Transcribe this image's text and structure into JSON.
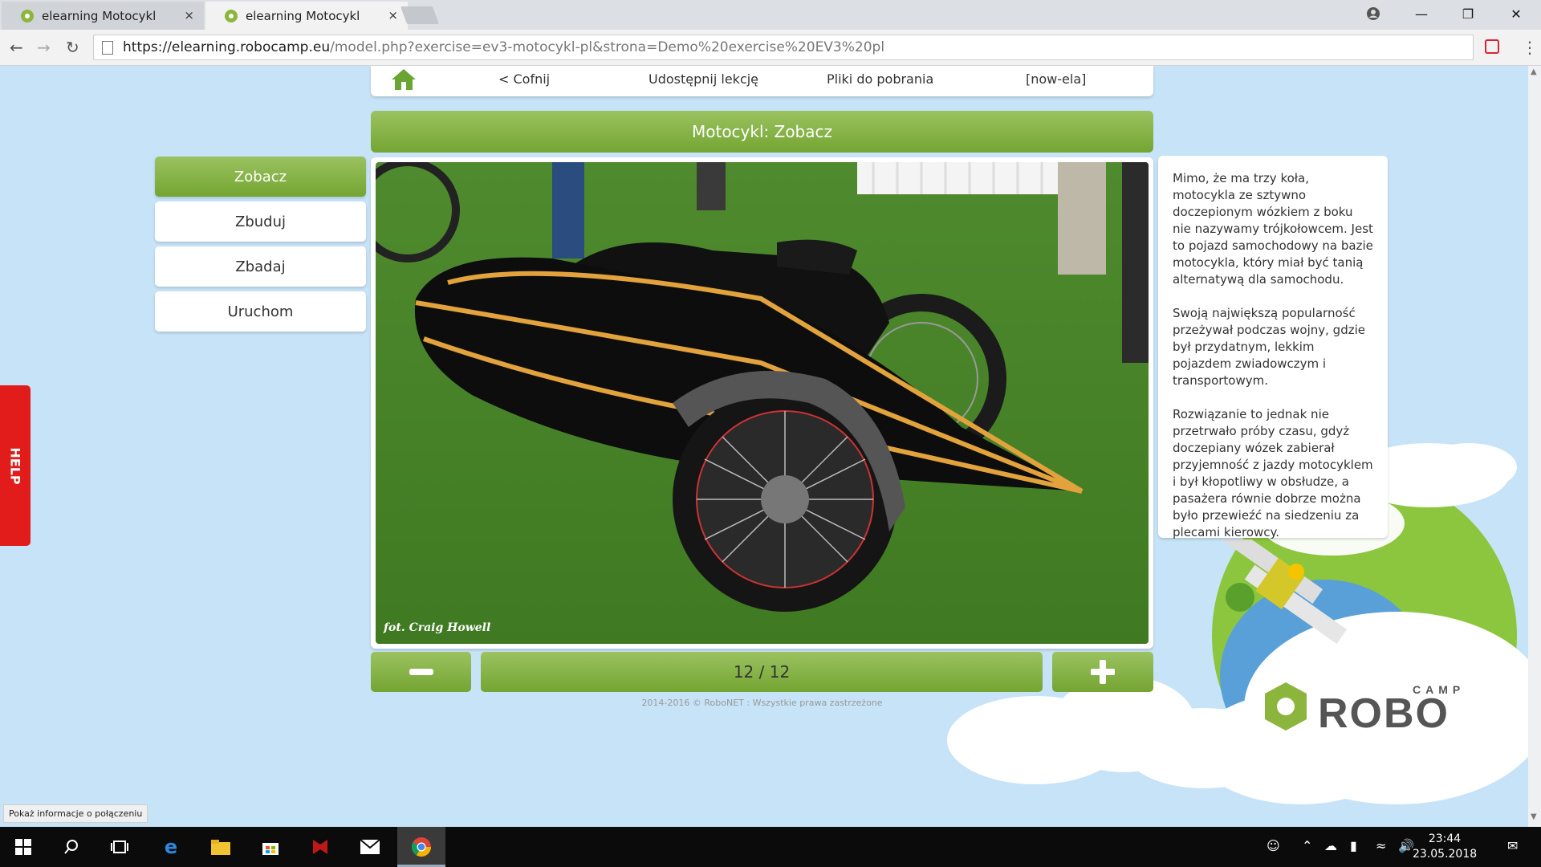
{
  "browser": {
    "tabs": [
      {
        "title": "elearning Motocykl",
        "close": "×"
      },
      {
        "title": "elearning Motocykl",
        "close": "×"
      }
    ],
    "window_controls": {
      "minimize": "—",
      "maximize": "❐",
      "close": "✕"
    },
    "url_host": "https://elearning.robocamp.eu",
    "url_rest": "/model.php?exercise=ev3-motocykl-pl&strona=Demo%20exercise%20EV3%20pl"
  },
  "topnav": {
    "back": "< Cofnij",
    "share": "Udostępnij lekcję",
    "downloads": "Pliki do pobrania",
    "user": "[now-ela]"
  },
  "title": "Motocykl: Zobacz",
  "sidebar": {
    "items": [
      {
        "label": "Zobacz",
        "active": true
      },
      {
        "label": "Zbuduj",
        "active": false
      },
      {
        "label": "Zbadaj",
        "active": false
      },
      {
        "label": "Uruchom",
        "active": false
      }
    ]
  },
  "photo": {
    "credit": "fot. Craig Howell"
  },
  "description": {
    "paragraphs": [
      "Mimo, że ma trzy koła, motocykla ze sztywno doczepionym wózkiem z boku nie nazywamy trójkołowcem. Jest to pojazd samochodowy na bazie motocykla, który miał być tanią alternatywą dla samochodu.",
      "Swoją największą popularność przeżywał podczas wojny, gdzie był przydatnym, lekkim pojazdem zwiadowczym i transportowym.",
      "Rozwiązanie to jednak nie przetrwało próby czasu, gdyż doczepiany wózek zabierał przyjemność z jazdy motocyklem i był kłopotliwy w obsłudze, a pasażera równie dobrze można było przewieźć na siedzeniu za plecami kierowcy."
    ]
  },
  "pager": {
    "label": "12 / 12",
    "current": 12,
    "total": 12
  },
  "footer": "2014-2016 © RoboNET : Wszystkie prawa zastrzeżone",
  "help": "HELP",
  "status_popup": "Pokaż informacje o połączeniu",
  "logo": {
    "small": "CAMP",
    "big": "ROBO"
  },
  "taskbar": {
    "time": "23:44",
    "date": "23.05.2018"
  },
  "colors": {
    "accent_green": "#8bb53d",
    "page_bg": "#c7e3f7",
    "help_red": "#e21b1b"
  }
}
